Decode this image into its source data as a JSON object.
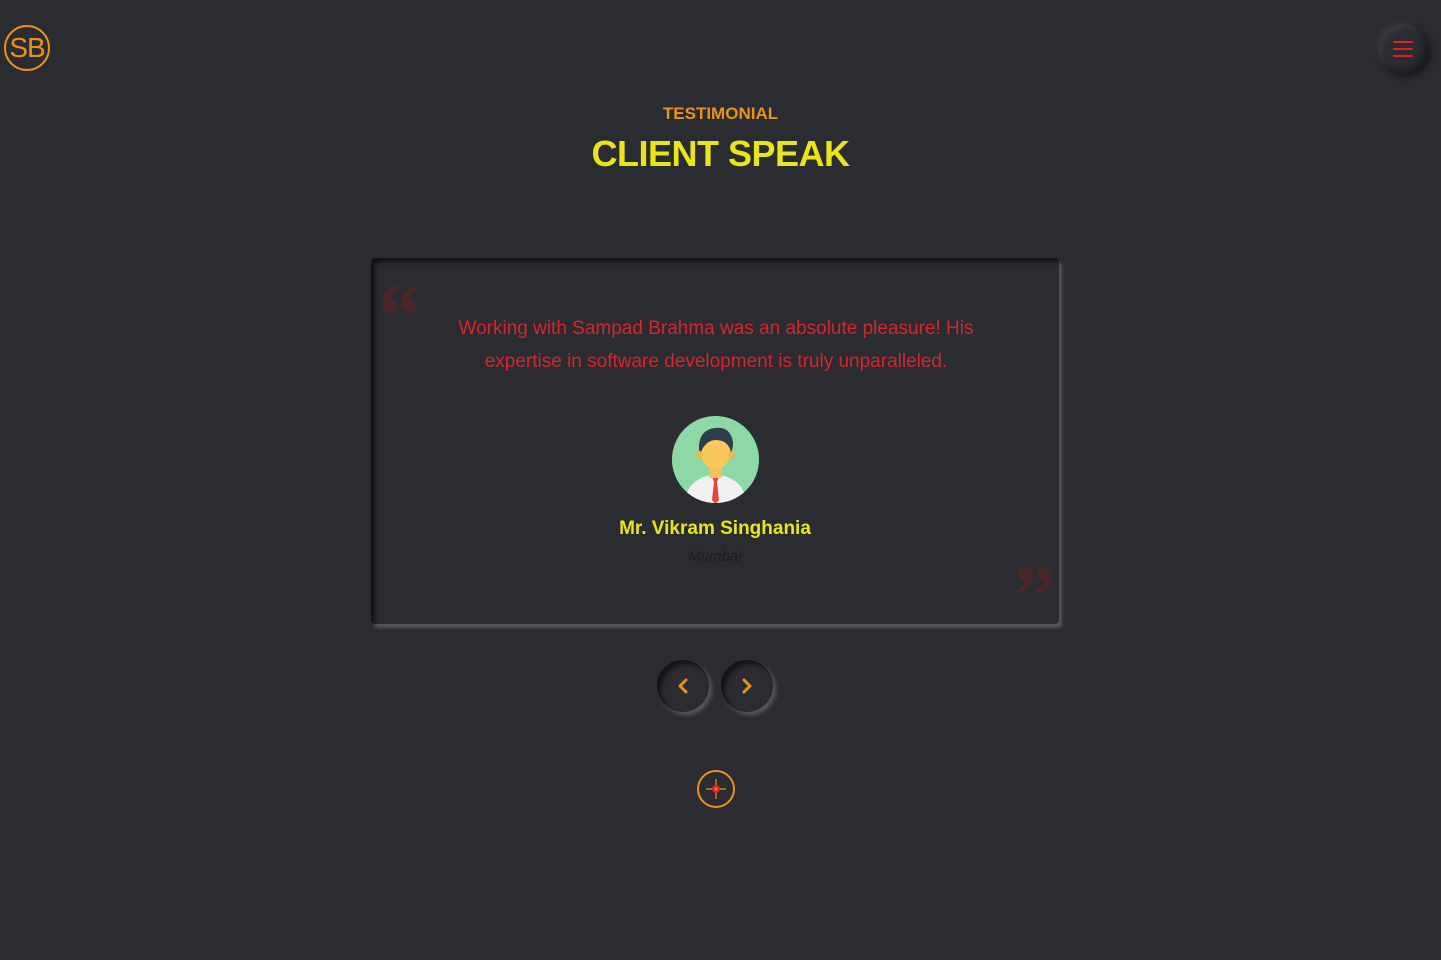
{
  "header": {
    "logo_text": "SB",
    "menu_icon": "hamburger-icon"
  },
  "section": {
    "eyebrow": "TESTIMONIAL",
    "title": "CLIENT SPEAK"
  },
  "testimonial": {
    "quote": "Working with Sampad Brahma was an absolute pleasure! His expertise in software development is truly unparalleled.",
    "name": "Mr. Vikram Singhania",
    "location": "Mumbai",
    "open_quote": "“",
    "close_quote": "”"
  },
  "carousel": {
    "prev_icon": "chevron-left-icon",
    "next_icon": "chevron-right-icon"
  },
  "footer": {
    "target_icon": "crosshair-icon"
  },
  "colors": {
    "background": "#2b2c31",
    "accent_orange": "#e8921c",
    "accent_yellow": "#e9e51b",
    "accent_red": "#d7262b"
  }
}
